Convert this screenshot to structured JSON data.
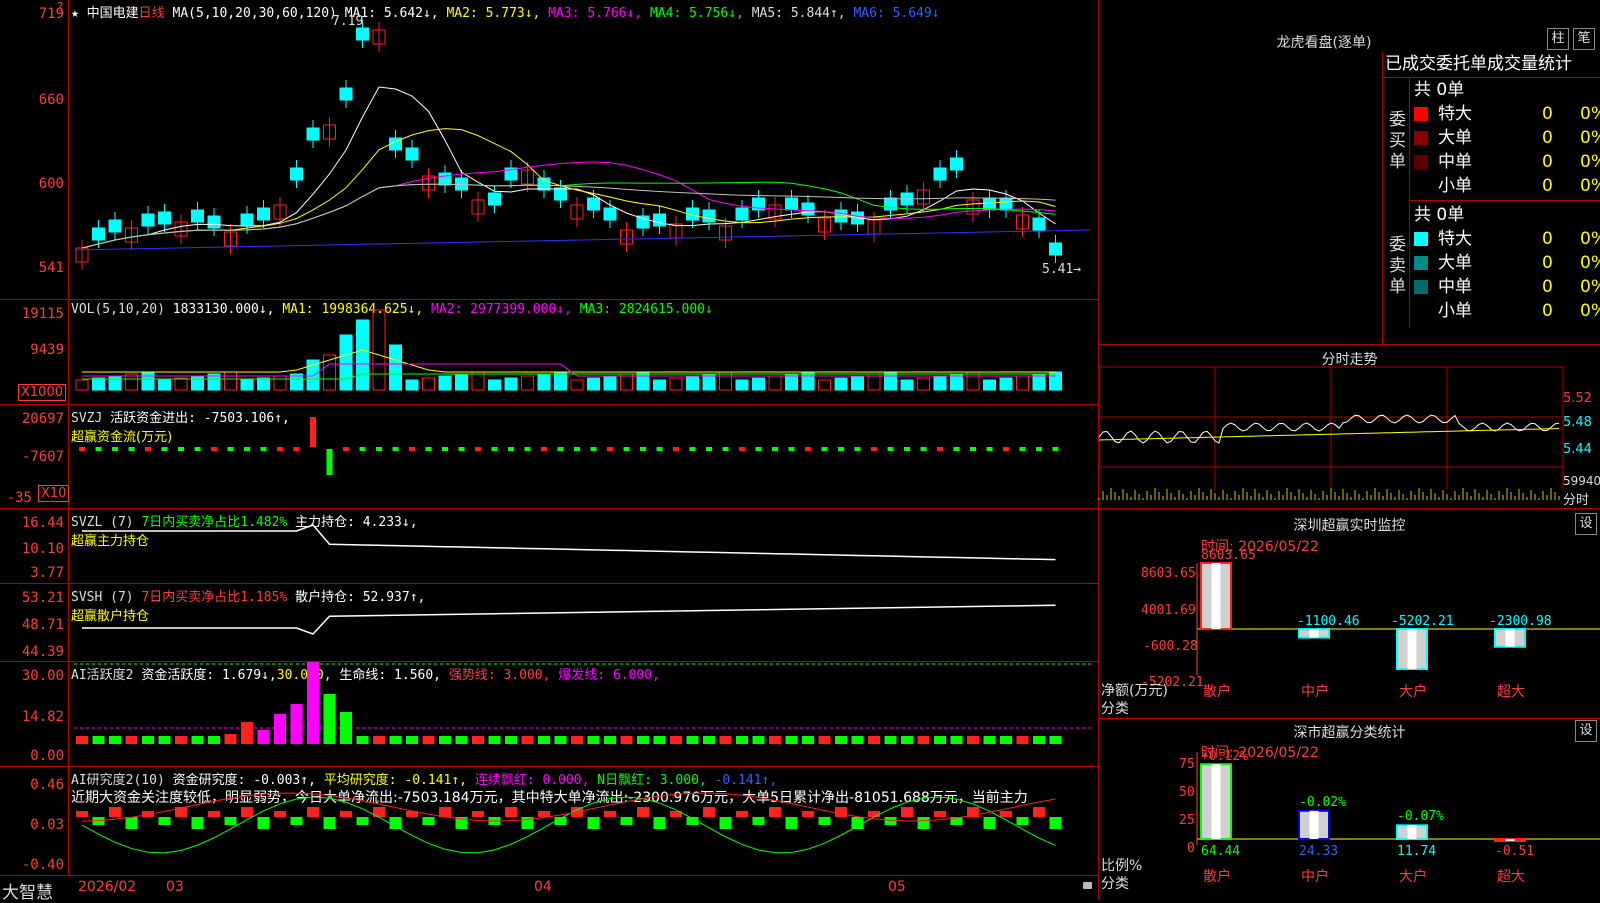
{
  "main": {
    "header": {
      "star": "★",
      "name": "中国电建",
      "period": "日线",
      "ma_params": "MA(5,10,20,30,60,120)",
      "ma1": "MA1: 5.642↓,",
      "ma2": "MA2: 5.773↓,",
      "ma3": "MA3: 5.766↓,",
      "ma4": "MA4: 5.756↓,",
      "ma5": "MA5: 5.844↑,",
      "ma6": "MA6: 5.649↓"
    },
    "ylabels": [
      "719",
      "660",
      "600",
      "541"
    ],
    "high_label": "7.19",
    "low_label": "5.41→",
    "marker": "?"
  },
  "vol": {
    "header": {
      "name": "VOL(5,10,20)",
      "val": "1833130.000↓,",
      "ma1": "MA1: 1998364.625↓,",
      "ma2": "MA2: 2977399.000↓,",
      "ma3": "MA3: 2824615.000↓"
    },
    "ylabels": [
      "19115",
      "9439",
      "X1000"
    ]
  },
  "svzj": {
    "header": {
      "name": "SVZJ",
      "text": "活跃资金进出: -7503.106↑,"
    },
    "sub": "超赢资金流(万元)",
    "ylabels": [
      "20697",
      "-7607",
      "-35"
    ],
    "unit": "X10"
  },
  "svzl": {
    "header": {
      "name": "SVZL (7)",
      "t1": "7日内买卖净占比1.482%",
      "t2": "主力持仓: 4.233↓,"
    },
    "sub": "超赢主力持仓",
    "ylabels": [
      "16.44",
      "10.10",
      "3.77"
    ]
  },
  "svsh": {
    "header": {
      "name": "SVSH (7)",
      "t1": "7日内买卖净占比1.185%",
      "t2": "散户持仓: 52.937↑,"
    },
    "sub": "超赢散户持仓",
    "ylabels": [
      "53.21",
      "48.71",
      "44.39"
    ]
  },
  "ai1": {
    "header": {
      "name": "AI活跃度2",
      "t1": "资金活跃度: 1.679↓,",
      "t2": "30.000,",
      "t3": "生命线: 1.560,",
      "t4": "强势线: 3.000,",
      "t5": "爆发线: 6.000,"
    },
    "ylabels": [
      "30.00",
      "14.82",
      "0.00"
    ]
  },
  "ai2": {
    "header": {
      "name": "AI研究度2(10)",
      "t1": "资金研究度: -0.003↑,",
      "t2": "平均研究度: -0.141↑,",
      "t3": "连续飘红: 0.000,",
      "t4": "N日飘红: 3.000,",
      "t5": "-0.141↑,"
    },
    "text": "近期大资金关注度较低，明显弱势，今日大单净流出:-7503.184万元，其中特大单净流出:-2300.976万元，大单5日累计净出-81051.688万元，当前主力",
    "ylabels": [
      "0.46",
      "0.03",
      "-0.40"
    ]
  },
  "footer": {
    "logo": "大智慧",
    "dates": [
      "2026/02",
      "03",
      "04",
      "05"
    ]
  },
  "dragon": {
    "title": "龙虎看盘(逐单)",
    "btn1": "柱",
    "btn2": "笔",
    "tab_title": "已成交委托单成交量统计",
    "buy_label": "委买单",
    "sell_label": "委卖单",
    "buy_total": "共 0单",
    "sell_total": "共 0单",
    "buy_rows": [
      {
        "label": "特大",
        "val": "0",
        "pct": "0%",
        "color": "#ff0000"
      },
      {
        "label": "大单",
        "val": "0",
        "pct": "0%",
        "color": "#8b0000"
      },
      {
        "label": "中单",
        "val": "0",
        "pct": "0%",
        "color": "#5a0000"
      },
      {
        "label": "小单",
        "val": "0",
        "pct": "0%",
        "color": "#000000"
      }
    ],
    "sell_rows": [
      {
        "label": "特大",
        "val": "0",
        "pct": "0%",
        "color": "#00ffff"
      },
      {
        "label": "大单",
        "val": "0",
        "pct": "0%",
        "color": "#008b8b"
      },
      {
        "label": "中单",
        "val": "0",
        "pct": "0%",
        "color": "#006b6b"
      },
      {
        "label": "小单",
        "val": "0",
        "pct": "0%",
        "color": "#000000"
      }
    ]
  },
  "intraday": {
    "title": "分时走势",
    "prices": [
      "5.52",
      "5.48",
      "5.44"
    ],
    "vol": "59940",
    "vol_unit": "分时"
  },
  "sz_monitor": {
    "title": "深圳超赢实时监控",
    "btn": "设",
    "time": "时间: 2026/05/22",
    "ylabels": [
      "8603.65",
      "4001.69",
      "-600.28",
      "-5202.21"
    ],
    "ylabel_unit": "净额(万元)",
    "xlabel_unit": "分类",
    "categories": [
      "散户",
      "中户",
      "大户",
      "超大"
    ],
    "value_labels": [
      "8603.65",
      "-1100.46",
      "-5202.21",
      "-2300.98"
    ]
  },
  "sz_class": {
    "title": "深市超赢分类统计",
    "btn": "设",
    "time": "时间: 2026/05/22",
    "ylabels": [
      "75",
      "50",
      "25",
      "0"
    ],
    "ylabel_unit": "比例%",
    "xlabel_unit": "分类",
    "categories": [
      "散户",
      "中户",
      "大户",
      "超大"
    ],
    "changes": [
      "+0.12%",
      "-0.02%",
      "-0.07%",
      ""
    ],
    "values": [
      "64.44",
      "24.33",
      "11.74",
      "-0.51"
    ]
  },
  "chart_data": [
    {
      "type": "bar",
      "title": "深圳超赢实时监控",
      "categories": [
        "散户",
        "中户",
        "大户",
        "超大"
      ],
      "values": [
        8603.65,
        -1100.46,
        -5202.21,
        -2300.98
      ],
      "ylabel": "净额(万元)",
      "xlabel": "分类",
      "ylim": [
        -5202.21,
        8603.65
      ]
    },
    {
      "type": "bar",
      "title": "深市超赢分类统计",
      "categories": [
        "散户",
        "中户",
        "大户",
        "超大"
      ],
      "values": [
        64.44,
        24.33,
        11.74,
        -0.51
      ],
      "ylabel": "比例%",
      "xlabel": "分类",
      "ylim": [
        0,
        75
      ]
    }
  ],
  "colors": {
    "up": "#ff2020",
    "down": "#00ffff",
    "grid": "#b00000",
    "ma1": "#ffffff",
    "ma2": "#ffff00",
    "ma3": "#ff00ff",
    "ma4": "#00ff00",
    "ma5": "#c0c0c0",
    "ma6": "#3030ff"
  }
}
